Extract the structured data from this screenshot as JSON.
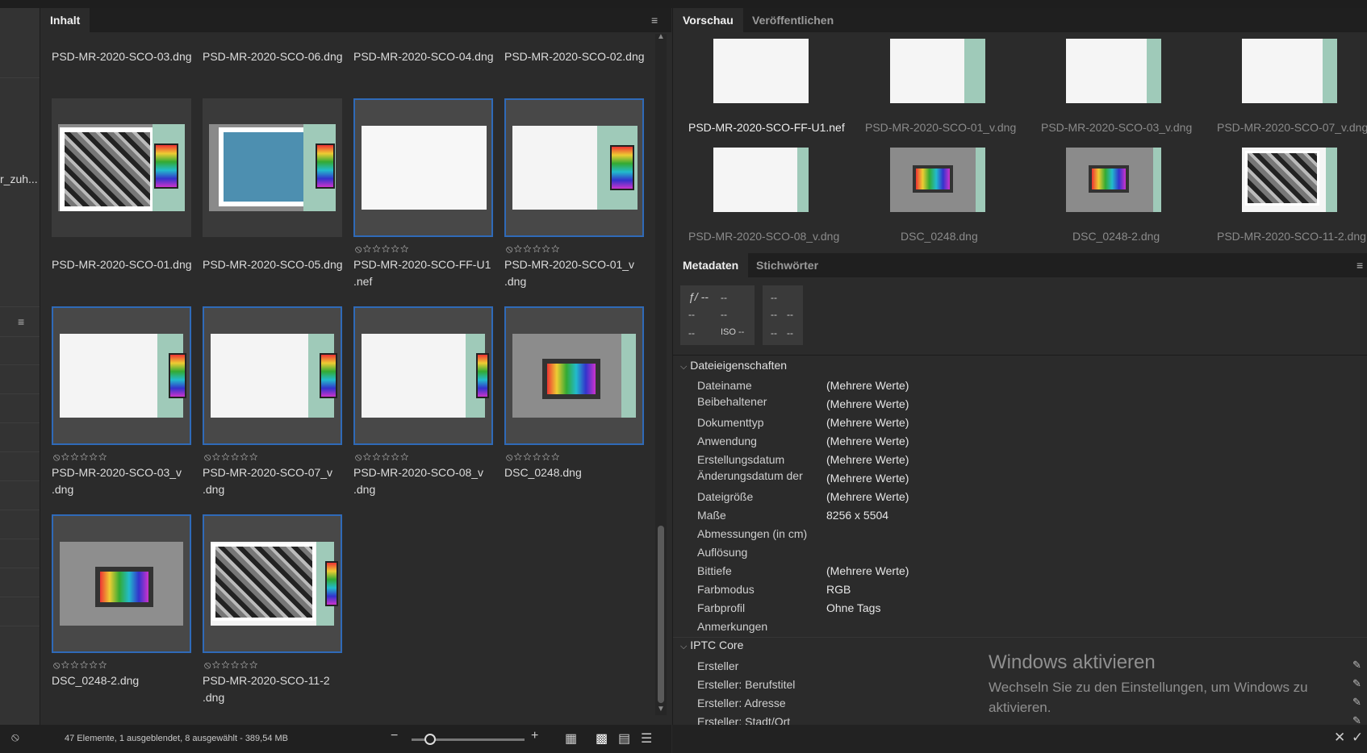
{
  "content": {
    "tab": "Inhalt",
    "top_labels": [
      "PSD-MR-2020-SCO-03.dng",
      "PSD-MR-2020-SCO-06.dng",
      "PSD-MR-2020-SCO-04.dng",
      "PSD-MR-2020-SCO-02.dng"
    ],
    "rows": [
      {
        "items": [
          {
            "line1": "PSD-MR-2020-SCO-01.dng",
            "line2": "",
            "rating": ""
          },
          {
            "line1": "PSD-MR-2020-SCO-05.dng",
            "line2": "",
            "rating": ""
          },
          {
            "line1": "PSD-MR-2020-SCO-FF-U1",
            "line2": ".nef",
            "rating": "⦸☆☆☆☆☆"
          },
          {
            "line1": "PSD-MR-2020-SCO-01_v",
            "line2": ".dng",
            "rating": "⦸☆☆☆☆☆"
          }
        ]
      },
      {
        "items": [
          {
            "line1": "PSD-MR-2020-SCO-03_v",
            "line2": ".dng",
            "rating": "⦸☆☆☆☆☆"
          },
          {
            "line1": "PSD-MR-2020-SCO-07_v",
            "line2": ".dng",
            "rating": "⦸☆☆☆☆☆"
          },
          {
            "line1": "PSD-MR-2020-SCO-08_v",
            "line2": ".dng",
            "rating": "⦸☆☆☆☆☆"
          },
          {
            "line1": "DSC_0248.dng",
            "line2": "",
            "rating": "⦸☆☆☆☆☆"
          }
        ]
      },
      {
        "items": [
          {
            "line1": "DSC_0248-2.dng",
            "line2": "",
            "rating": "⦸☆☆☆☆☆"
          },
          {
            "line1": "PSD-MR-2020-SCO-11-2",
            "line2": ".dng",
            "rating": "⦸☆☆☆☆☆"
          }
        ]
      }
    ],
    "status": "47 Elemente, 1 ausgeblendet, 8 ausgewählt - 389,54 MB"
  },
  "left": {
    "truncated_label": "r_zuh..."
  },
  "preview": {
    "tabs": [
      "Vorschau",
      "Veröffentlichen"
    ],
    "items": [
      "PSD-MR-2020-SCO-FF-U1.nef",
      "PSD-MR-2020-SCO-01_v.dng",
      "PSD-MR-2020-SCO-03_v.dng",
      "PSD-MR-2020-SCO-07_v.dng",
      "PSD-MR-2020-SCO-08_v.dng",
      "DSC_0248.dng",
      "DSC_0248-2.dng",
      "PSD-MR-2020-SCO-11-2.dng"
    ]
  },
  "metadata": {
    "tabs": [
      "Metadaten",
      "Stichwörter"
    ],
    "exif": {
      "aperture": "ƒ/ --",
      "shutter": "--",
      "r2a": "--",
      "r2b": "--",
      "r3a": "--",
      "iso": "ISO --",
      "b1": "--",
      "b2a": "--",
      "b2b": "--",
      "b3a": "--",
      "b3b": "--"
    },
    "section1": "Dateieigenschaften",
    "rows": [
      {
        "key": "Dateiname",
        "value": "(Mehrere Werte)"
      },
      {
        "key": "Beibehaltener",
        "value": "(Mehrere Werte)"
      },
      {
        "key": "Dokumenttyp",
        "value": "(Mehrere Werte)"
      },
      {
        "key": "Anwendung",
        "value": "(Mehrere Werte)"
      },
      {
        "key": "Erstellungsdatum",
        "value": "(Mehrere Werte)"
      },
      {
        "key": "Änderungsdatum der",
        "value": "(Mehrere Werte)"
      },
      {
        "key": "Dateigröße",
        "value": "(Mehrere Werte)"
      },
      {
        "key": "Maße",
        "value": "8256 x 5504"
      },
      {
        "key": "Abmessungen (in cm)",
        "value": ""
      },
      {
        "key": "Auflösung",
        "value": ""
      },
      {
        "key": "Bittiefe",
        "value": "(Mehrere Werte)"
      },
      {
        "key": "Farbmodus",
        "value": "RGB"
      },
      {
        "key": "Farbprofil",
        "value": "Ohne Tags"
      },
      {
        "key": "Anmerkungen",
        "value": ""
      }
    ],
    "section2": "IPTC Core",
    "iptc_rows": [
      "Ersteller",
      "Ersteller: Berufstitel",
      "Ersteller: Adresse",
      "Ersteller: Stadt/Ort"
    ]
  },
  "watermark": {
    "title": "Windows aktivieren",
    "text": "Wechseln Sie zu den Einstellungen, um Windows zu aktivieren."
  }
}
